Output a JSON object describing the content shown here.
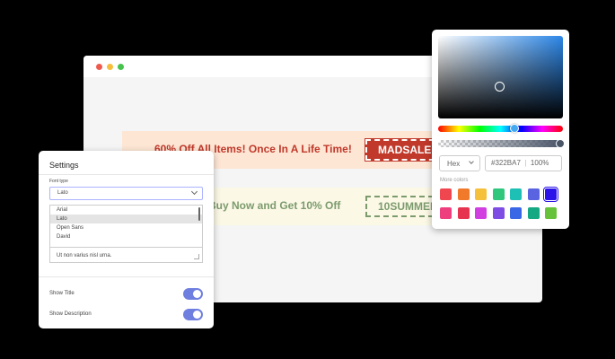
{
  "banners": {
    "first_text": "60% Off All Items! Once In A Life Time!",
    "first_coupon": "MADSALE",
    "second_text": "Buy Now and Get 10% Off",
    "second_coupon": "10SUMMER"
  },
  "settings": {
    "title": "Settings",
    "font_label": "Font type",
    "font_selected": "Lato",
    "font_options": [
      "Arial",
      "Lato",
      "Open Sans",
      "David"
    ],
    "highlighted_option": "Lato",
    "textarea_value": "Ut non varius nisl urna.",
    "toggles": [
      {
        "label": "Show Title",
        "on": true
      },
      {
        "label": "Show Description",
        "on": true
      }
    ]
  },
  "color_picker": {
    "mode": "Hex",
    "hex_value": "#322BA7",
    "opacity": "100%",
    "more_colors_label": "More colors",
    "swatches_row1": [
      "#f0464f",
      "#f07a2a",
      "#f5c03a",
      "#2ec77c",
      "#1ebfb4",
      "#5a64e0",
      "#2a12e8"
    ],
    "swatches_row2": [
      "#ee3e7e",
      "#e6334f",
      "#d13fe0",
      "#7e4de3",
      "#3a67e6",
      "#14a883",
      "#66c23a"
    ]
  },
  "colors": {
    "accent": "#6f7fe0",
    "banner1_bg": "#fde6d4",
    "banner1_fg": "#c0392b",
    "banner2_bg": "#fbf8e6",
    "banner2_fg": "#7c9b6d"
  }
}
